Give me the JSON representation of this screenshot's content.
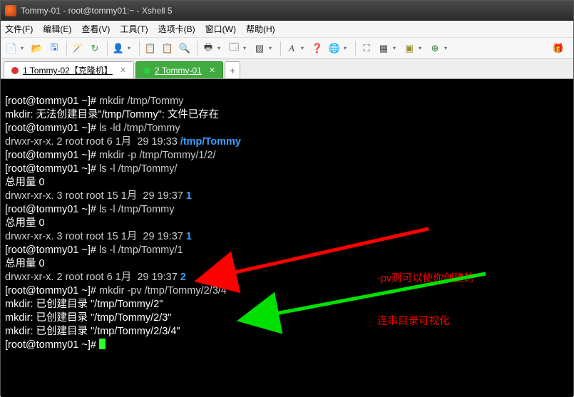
{
  "window": {
    "title": "Tommy-01 - root@tommy01:~ - Xshell 5"
  },
  "menu": {
    "file": "文件(F)",
    "edit": "编辑(E)",
    "view": "查看(V)",
    "tools": "工具(T)",
    "tabs": "选项卡(B)",
    "window": "窗口(W)",
    "help": "帮助(H)"
  },
  "tabs": {
    "t1": "1 Tommy-02【克隆机】",
    "t2": "2 Tommy-01"
  },
  "annot": {
    "l1": "-pv则可以使你创建的",
    "l2": "连串目录可视化"
  },
  "term": {
    "l1a": "[root@tommy01 ~]# ",
    "l1b": "mkdir /tmp/Tommy",
    "l2a": "mkdir: 无法创建目录\"/tmp/Tommy\": 文件已存在",
    "l3a": "[root@tommy01 ~]# ",
    "l3b": "ls -ld /tmp/Tommy",
    "l4a": "drwxr-xr-x. 2 root root 6 1月  29 19:33 ",
    "l4b": "/tmp/Tommy",
    "l5a": "[root@tommy01 ~]# ",
    "l5b": "mkdir -p /tmp/Tommy/1/2/",
    "l6a": "[root@tommy01 ~]# ",
    "l6b": "ls -l /tmp/Tommy/",
    "l7": "总用量 0",
    "l8a": "drwxr-xr-x. 3 root root 15 1月  29 19:37 ",
    "l8b": "1",
    "l9a": "[root@tommy01 ~]# ",
    "l9b": "ls -l /tmp/Tommy",
    "l10": "总用量 0",
    "l11a": "drwxr-xr-x. 3 root root 15 1月  29 19:37 ",
    "l11b": "1",
    "l12a": "[root@tommy01 ~]# ",
    "l12b": "ls -l /tmp/Tommy/1",
    "l13": "总用量 0",
    "l14a": "drwxr-xr-x. 2 root root 6 1月  29 19:37 ",
    "l14b": "2",
    "l15a": "[root@tommy01 ~]# ",
    "l15b": "mkdir -pv /tmp/Tommy/2/3/4",
    "l16": "mkdir: 已创建目录 \"/tmp/Tommy/2\"",
    "l17": "mkdir: 已创建目录 \"/tmp/Tommy/2/3\"",
    "l18": "mkdir: 已创建目录 \"/tmp/Tommy/2/3/4\"",
    "l19a": "[root@tommy01 ~]# "
  }
}
